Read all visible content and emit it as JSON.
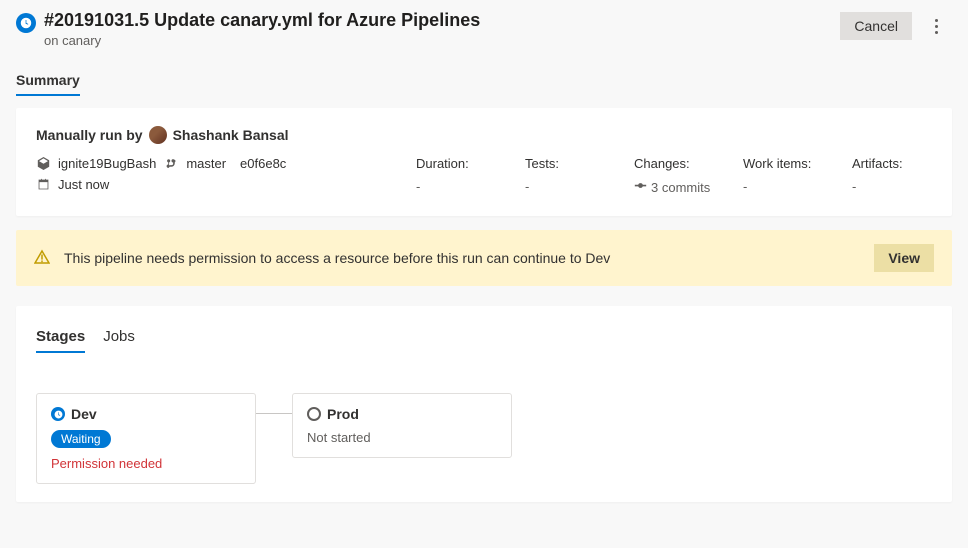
{
  "header": {
    "title": "#20191031.5 Update canary.yml for Azure Pipelines",
    "subtitle": "on canary",
    "cancel": "Cancel"
  },
  "tab_summary": "Summary",
  "summary": {
    "run_by_label": "Manually run by",
    "user": "Shashank Bansal",
    "repo": "ignite19BugBash",
    "branch": "master",
    "commit": "e0f6e8c",
    "time": "Just now",
    "columns": {
      "duration": {
        "label": "Duration:",
        "value": "-"
      },
      "tests": {
        "label": "Tests:",
        "value": "-"
      },
      "changes": {
        "label": "Changes:",
        "value": "3 commits"
      },
      "workitems": {
        "label": "Work items:",
        "value": "-"
      },
      "artifacts": {
        "label": "Artifacts:",
        "value": "-"
      }
    }
  },
  "alert": {
    "text": "This pipeline needs permission to access a resource before this run can continue to Dev",
    "button": "View"
  },
  "stages": {
    "tab_stages": "Stages",
    "tab_jobs": "Jobs",
    "dev": {
      "name": "Dev",
      "badge": "Waiting",
      "note": "Permission needed"
    },
    "prod": {
      "name": "Prod",
      "note": "Not started"
    }
  }
}
